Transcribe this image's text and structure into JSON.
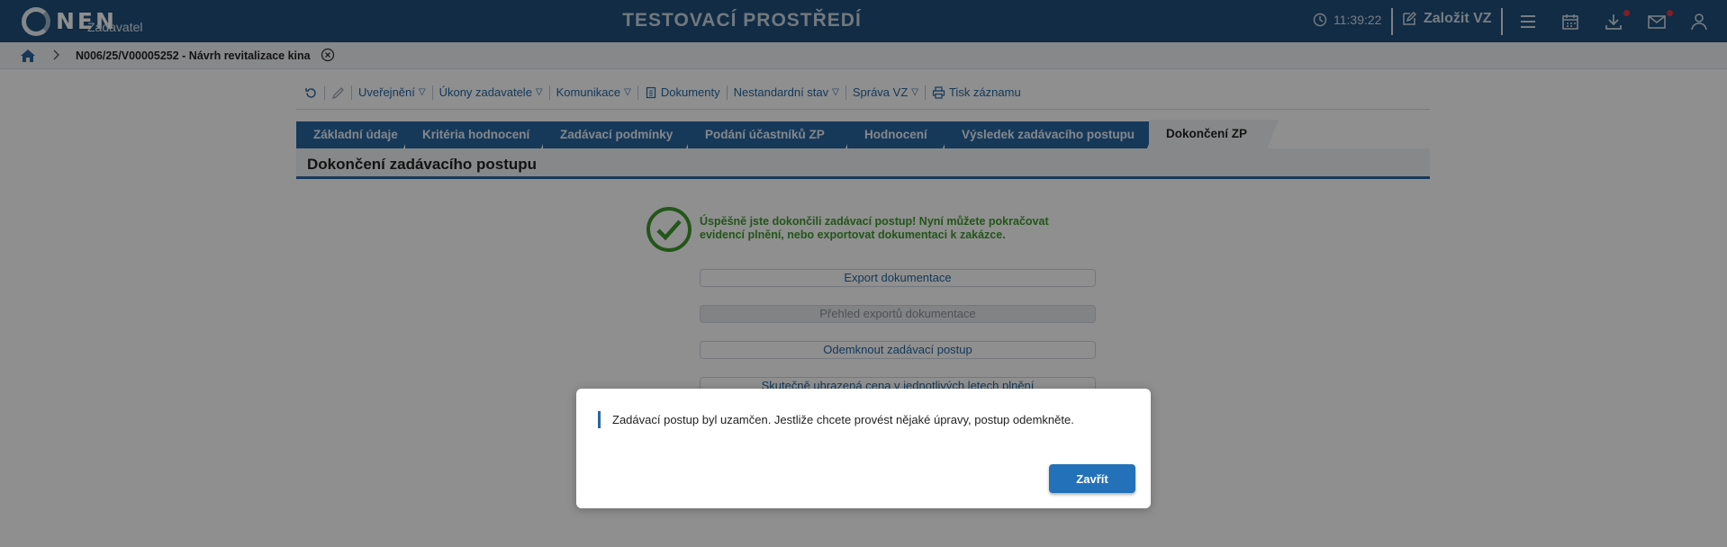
{
  "header": {
    "logo_text": "NEN",
    "logo_subtitle": "Zadavatel",
    "environment_title": "TESTOVACÍ PROSTŘEDÍ",
    "clock": "11:39:22",
    "create_label": "Založit VZ",
    "icons": [
      "clock-icon",
      "edit-icon",
      "hamburger-menu-icon",
      "calendar-icon",
      "download-icon",
      "mail-icon",
      "user-icon"
    ],
    "notification_color": "#e0394a"
  },
  "breadcrumb": {
    "current": "N006/25/V00005252 - Návrh revitalizace kina"
  },
  "toolbar": {
    "items": [
      "Uveřejnění",
      "Úkony zadavatele",
      "Komunikace",
      "Dokumenty",
      "Nestandardní stav",
      "Správa VZ",
      "Tisk záznamu"
    ]
  },
  "tabs": [
    "Základní údaje",
    "Kritéria hodnocení",
    "Zadávací podmínky",
    "Podání účastníků ZP",
    "Hodnocení",
    "Výsledek zadávacího postupu",
    "Dokončení ZP"
  ],
  "section": {
    "title": "Dokončení zadávacího postupu",
    "success_message": "Úspěšně jste dokončili zadávací postup! Nyní můžete pokračovat evidencí plnění, nebo exportovat dokumentaci k zakázce.",
    "buttons": [
      "Export dokumentace",
      "Přehled exportů dokumentace",
      "Odemknout zadávací postup",
      "Skutečně uhrazená cena v jednotlivých letech plnění"
    ]
  },
  "modal": {
    "message": "Zadávací postup byl uzamčen. Jestliže chcete provést nějaké úpravy, postup odemkněte.",
    "close_label": "Zavřít"
  },
  "colors": {
    "header_bg": "#1f4f7a",
    "tab_bg": "#2866a0",
    "success": "#3d9a2b",
    "primary_button": "#2371b8"
  }
}
